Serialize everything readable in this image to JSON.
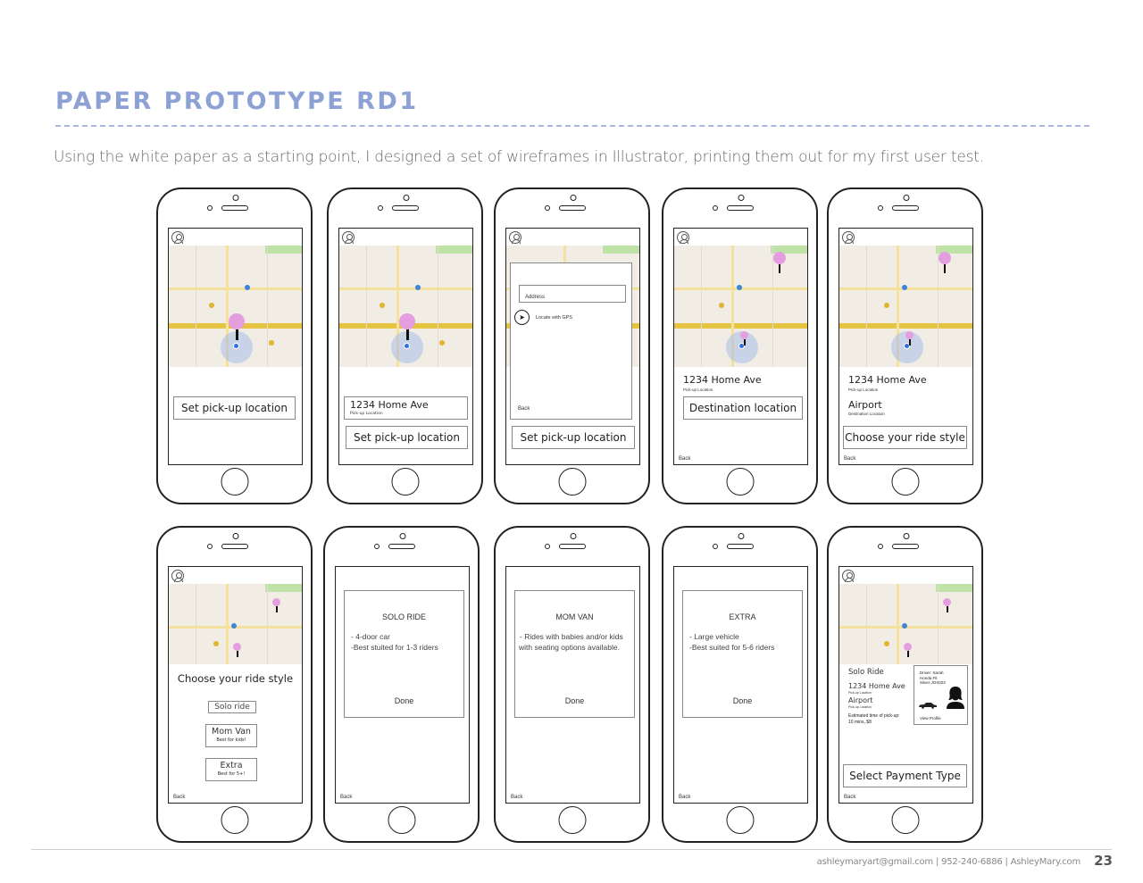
{
  "page": {
    "title": "PAPER PROTOTYPE RD1",
    "subtitle": "Using the white paper as a starting point, I designed a set of wireframes in Illustrator, printing them out for my first user test.",
    "accent_color": "#8ea1d4",
    "pin_color": "#e49ee0"
  },
  "screens": {
    "s1": {
      "button": "Set pick-up location"
    },
    "s2": {
      "address": "1234 Home Ave",
      "address_sub": "Pick-up Location",
      "button": "Set pick-up location"
    },
    "s3": {
      "address_placeholder": "Address",
      "gps_label": "Locate with GPS",
      "back": "Back",
      "button": "Set pick-up location"
    },
    "s4": {
      "address": "1234 Home Ave",
      "address_sub": "Pick-up Location",
      "button": "Destination location",
      "back": "Back"
    },
    "s5": {
      "address": "1234 Home Ave",
      "address_sub": "Pick-up Location",
      "destination": "Airport",
      "destination_sub": "Destination Location",
      "button": "Choose your ride style",
      "back": "Back"
    },
    "s6": {
      "heading": "Choose your ride style",
      "options": [
        {
          "label": "Solo ride",
          "sub": ""
        },
        {
          "label": "Mom Van",
          "sub": "Best for kids!"
        },
        {
          "label": "Extra",
          "sub": "Best for 5+!"
        }
      ],
      "back": "Back"
    },
    "s7": {
      "title": "SOLO RIDE",
      "line1": "- 4-door car",
      "line2": "-Best stuited for 1-3 riders",
      "done": "Done",
      "back": "Back"
    },
    "s8": {
      "title": "MOM VAN",
      "line1": "- Rides with babies and/or kids",
      "line2": "with seating options available.",
      "done": "Done",
      "back": "Back"
    },
    "s9": {
      "title": "EXTRA",
      "line1": "- Large vehicle",
      "line2": "-Best suited for 5-6 riders",
      "done": "Done",
      "back": "Back"
    },
    "s10": {
      "ride_type": "Solo Ride",
      "address": "1234 Home Ave",
      "address_sub": "Pick-up Location",
      "destination": "Airport",
      "destination_sub": "Pick-up Location",
      "eta_label": "Estimated time of pick-up:",
      "eta_value": "10 mins, $8",
      "driver_name": "Driver: Sarah",
      "driver_car": "Honda Fit",
      "driver_plate": "Silver JOX023",
      "view_profile": "View Profile",
      "button": "Select Payment Type",
      "back": "Back"
    }
  },
  "footer": {
    "contact": "ashleymaryart@gmail.com | 952-240-6886 | AshleyMary.com",
    "page_number": "23"
  }
}
